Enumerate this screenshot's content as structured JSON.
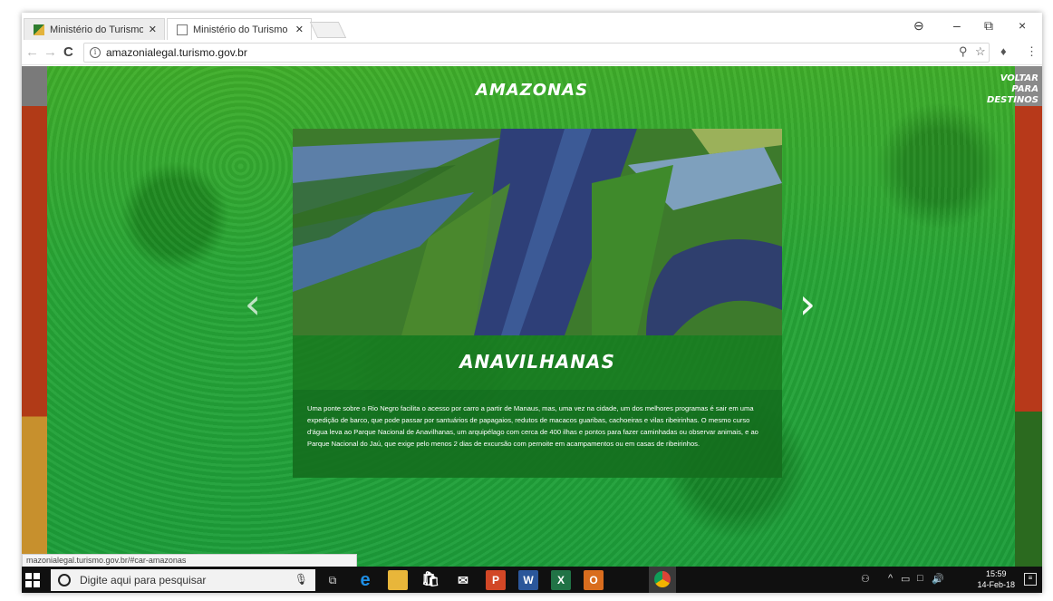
{
  "browser": {
    "tabs": [
      {
        "title": "Ministério do Turismo - ",
        "close": "✕"
      },
      {
        "title": "Ministério do Turismo - ",
        "close": "✕"
      }
    ],
    "url": "amazonialegal.turismo.gov.br",
    "status_url": "mazonialegal.turismo.gov.br/#car-amazonas"
  },
  "page": {
    "state_title": "AMAZONAS",
    "back_link": "VOLTAR PARA DESTINOS",
    "prev_arrow": "‹",
    "next_arrow": "›",
    "card": {
      "name": "ANAVILHANAS",
      "description": "Uma ponte sobre o Rio Negro facilita o acesso por carro a partir de Manaus, mas, uma vez na cidade, um dos melhores programas é sair em uma expedição de barco, que pode passar por santuários de papagaios, redutos de macacos guaribas, cachoeiras e vilas ribeirinhas. O mesmo curso d'água leva ao Parque Nacional de Anavilhanas, um arquipélago com cerca de 400 ilhas e pontos para fazer caminhadas ou observar animais, e ao Parque Nacional do Jaú, que exige pelo menos 2 dias de excursão com pernoite em acampamentos ou em casas de ribeirinhos."
    }
  },
  "taskbar": {
    "search_placeholder": "Digite aqui para pesquisar",
    "time": "15:59",
    "date": "14-Feb-18"
  },
  "colors": {
    "page_green": "#28a636",
    "card_band": "#19781e",
    "taskbar": "#101010"
  }
}
